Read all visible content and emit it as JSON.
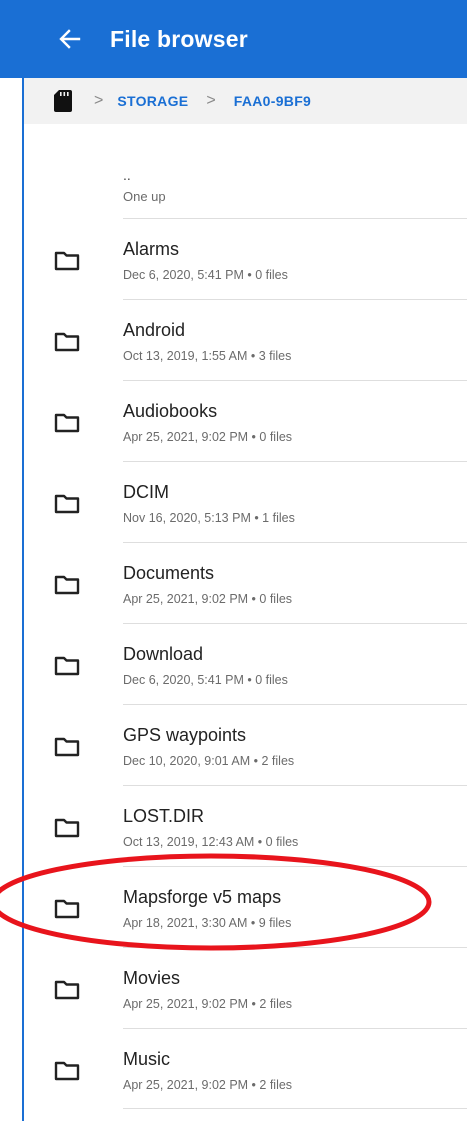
{
  "appbar": {
    "title": "File browser",
    "back_icon": "arrow-left-icon",
    "color": "#1a6fd4"
  },
  "breadcrumb": {
    "root_icon": "sd-card-icon",
    "items": [
      "STORAGE",
      "FAA0-9BF9"
    ]
  },
  "up_item": {
    "label": "..",
    "subtitle": "One up"
  },
  "folders": [
    {
      "name": "Alarms",
      "meta": "Dec 6, 2020, 5:41 PM • 0 files"
    },
    {
      "name": "Android",
      "meta": "Oct 13, 2019, 1:55 AM • 3 files"
    },
    {
      "name": "Audiobooks",
      "meta": "Apr 25, 2021, 9:02 PM • 0 files"
    },
    {
      "name": "DCIM",
      "meta": "Nov 16, 2020, 5:13 PM • 1 files"
    },
    {
      "name": "Documents",
      "meta": "Apr 25, 2021, 9:02 PM • 0 files"
    },
    {
      "name": "Download",
      "meta": "Dec 6, 2020, 5:41 PM • 0 files"
    },
    {
      "name": "GPS waypoints",
      "meta": "Dec 10, 2020, 9:01 AM • 2 files"
    },
    {
      "name": "LOST.DIR",
      "meta": "Oct 13, 2019, 12:43 AM • 0 files"
    },
    {
      "name": "Mapsforge v5 maps",
      "meta": "Apr 18, 2021, 3:30 AM • 9 files"
    },
    {
      "name": "Movies",
      "meta": "Apr 25, 2021, 9:02 PM • 2 files"
    },
    {
      "name": "Music",
      "meta": "Apr 25, 2021, 9:02 PM • 2 files"
    }
  ],
  "annotation": {
    "color": "#e8141c",
    "highlighted_folder": "Mapsforge v5 maps"
  }
}
